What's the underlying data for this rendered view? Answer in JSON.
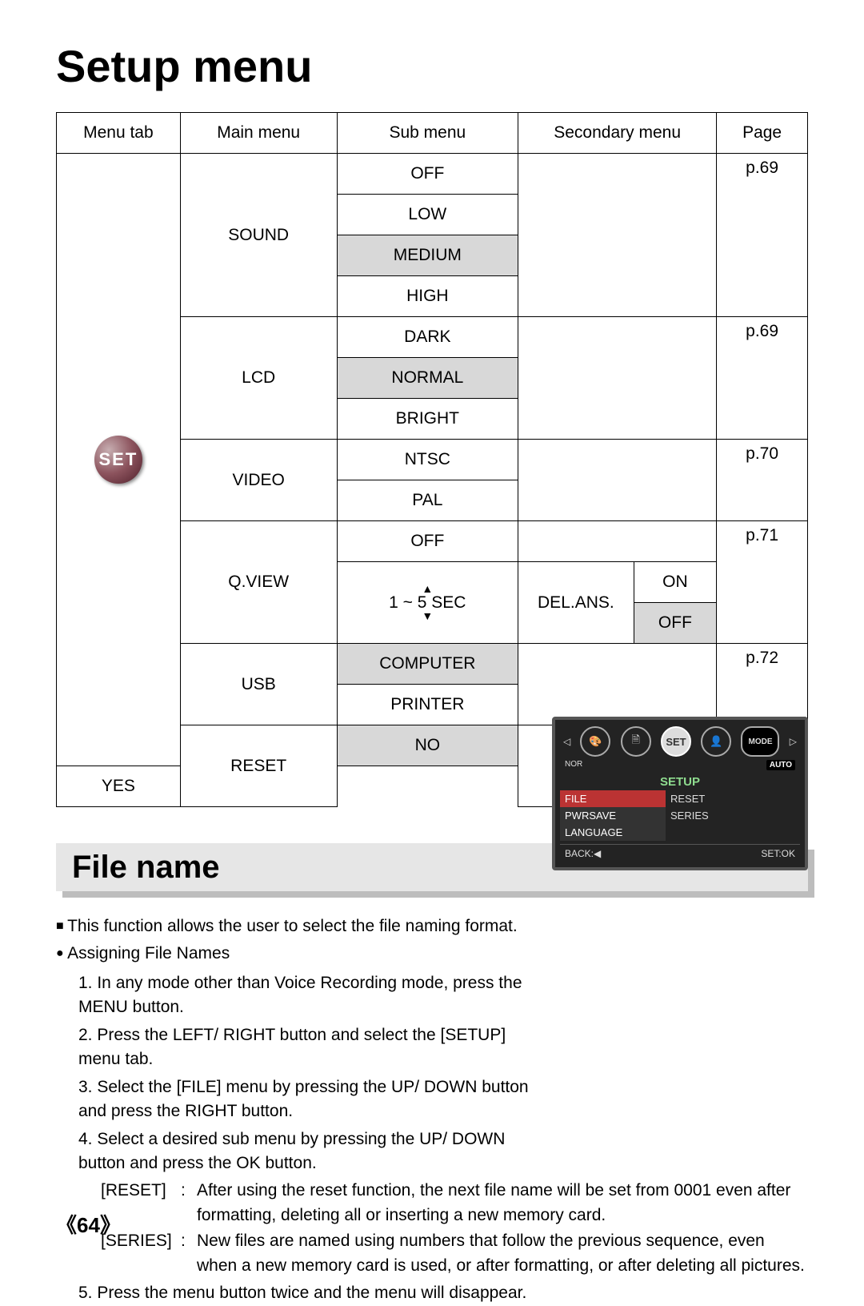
{
  "title": "Setup menu",
  "headers": {
    "menutab": "Menu tab",
    "mainmenu": "Main menu",
    "submenu": "Sub menu",
    "secondary": "Secondary menu",
    "page": "Page"
  },
  "set_icon_text": "SET",
  "main": {
    "sound": "SOUND",
    "lcd": "LCD",
    "video": "VIDEO",
    "qview": "Q.VIEW",
    "usb": "USB",
    "reset": "RESET"
  },
  "sub": {
    "sound_off": "OFF",
    "sound_low": "LOW",
    "sound_medium": "MEDIUM",
    "sound_high": "HIGH",
    "lcd_dark": "DARK",
    "lcd_normal": "NORMAL",
    "lcd_bright": "BRIGHT",
    "video_ntsc": "NTSC",
    "video_pal": "PAL",
    "qview_off": "OFF",
    "qview_range": "1 ~ 5 SEC",
    "usb_computer": "COMPUTER",
    "usb_printer": "PRINTER",
    "reset_no": "NO",
    "reset_yes": "YES"
  },
  "secondary": {
    "delans": "DEL.ANS.",
    "on": "ON",
    "off": "OFF"
  },
  "pages": {
    "p69a": "p.69",
    "p69b": "p.69",
    "p70": "p.70",
    "p71": "p.71",
    "p72a": "p.72",
    "p72b": "p.72"
  },
  "section2": "File name",
  "para": {
    "intro": "This function allows the user to select the file naming format.",
    "assigning": "Assigning File Names",
    "s1": "1. In any mode other than Voice Recording mode, press the MENU button.",
    "s2": "2. Press the LEFT/ RIGHT button and select the [SETUP] menu tab.",
    "s3": "3. Select the [FILE] menu by pressing the UP/ DOWN button and press the RIGHT button.",
    "s4": "4. Select a desired sub menu by pressing the UP/ DOWN button and press the OK button.",
    "reset_l": "[RESET]",
    "reset_t": "After using the reset function, the next file name will be set from 0001 even after formatting, deleting all or inserting a new memory card.",
    "series_l": "[SERIES]",
    "series_t": "New files are named using numbers that follow the previous sequence, even when a new memory card is used, or after formatting, or after deleting all pictures.",
    "s5": "5. Press the menu button twice and the menu will disappear."
  },
  "lcd": {
    "set": "SET",
    "mode": "MODE",
    "nor": "NOR",
    "auto": "AUTO",
    "setup": "SETUP",
    "file": "FILE",
    "reset": "RESET",
    "pwrsave": "PWRSAVE",
    "series": "SERIES",
    "language": "LANGUAGE",
    "back": "BACK:◀",
    "setok": "SET:OK"
  },
  "pagenum": "64",
  "pagenum_l": "《",
  "pagenum_r": "》"
}
